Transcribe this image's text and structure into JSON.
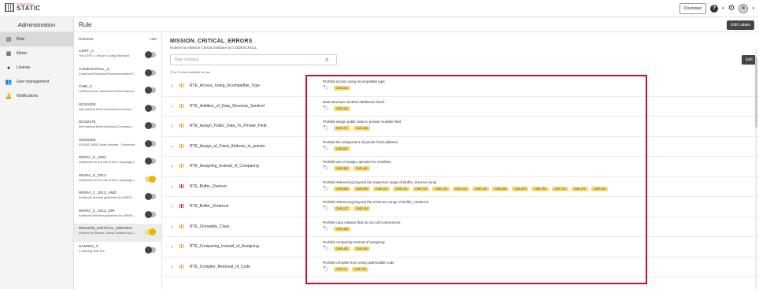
{
  "header": {
    "logo_small": "CODESCROLL",
    "logo_big": "STATIC",
    "download_label": "Download",
    "help_icon": "?"
  },
  "sidebar": {
    "title": "Administration",
    "items": [
      {
        "label": "Rule",
        "icon": "rule-book-icon",
        "active": true
      },
      {
        "label": "Metric",
        "icon": "metric-icon"
      },
      {
        "label": "License",
        "icon": "license-icon"
      },
      {
        "label": "User management",
        "icon": "users-icon"
      },
      {
        "label": "Notifications",
        "icon": "bell-icon"
      }
    ]
  },
  "page": {
    "title": "Rule",
    "edit_labels": "Edit Labels"
  },
  "rulesets": {
    "header_label": "Rulesets",
    "header_use": "Use",
    "items": [
      {
        "name": "CERT_C",
        "desc": "The CERT C Secure Coding Standard",
        "on": false
      },
      {
        "name": "CODESCROLL_C",
        "desc": "CodeScroll Essential Recommendation R...",
        "on": false
      },
      {
        "name": "CWE_C",
        "desc": "CWE(Common Weakness Enumeration) f...",
        "on": false
      },
      {
        "name": "IEC61508",
        "desc": "International Electrotechnical Commissi...",
        "on": false
      },
      {
        "name": "IEC62279",
        "desc": "International Electrotechnical Commissi...",
        "on": false
      },
      {
        "name": "ISO26262",
        "desc": "ISO/DIS 26262 Road vehicles - Functional ...",
        "on": false
      },
      {
        "name": "MISRA_C_2004",
        "desc": "Guidelines for the use of the C language i...",
        "on": false
      },
      {
        "name": "MISRA_C_2012",
        "desc": "Guidelines for the use of the C language i...",
        "on": true
      },
      {
        "name": "MISRA_C_2012_AMD",
        "desc": "Additional security guidelines for MISRA ...",
        "on": false
      },
      {
        "name": "MISRA_C_2012_DIR",
        "desc": "Additional directive guidelines for MISRA ...",
        "on": false
      },
      {
        "name": "MISSION_CRITICAL_ERRORS",
        "desc": "Ruleset for Mission Critical Software by C...",
        "on": true,
        "active": true
      },
      {
        "name": "NAMING_C",
        "desc": "C Naming Rule Set",
        "on": false
      }
    ]
  },
  "content": {
    "title": "MISSION_CRITICAL_ERRORS",
    "subtitle": "Ruleset for Mission Critical Software by CODESCROLL",
    "search_placeholder": "Rule contains",
    "edit_label": "Edit",
    "selected_info": "75 of 75 rules selected for use"
  },
  "rules": [
    {
      "name": "RTE_Access_Using_Incompatible_Type",
      "severity": "medium",
      "desc": "Prohibit access using incompatible type",
      "tags": [
        "CWE-843"
      ]
    },
    {
      "name": "RTE_Addition_of_Data_Structure_Sentinel",
      "severity": "medium",
      "desc": "Data structure sentinel additional check",
      "tags": [
        "CWE-464"
      ]
    },
    {
      "name": "RTE_Assign_Public_Data_To_Private_Field",
      "severity": "medium",
      "desc": "Prohibit assign public data to private mutable field",
      "tags": [
        "CWE-767",
        "CWE-496"
      ]
    },
    {
      "name": "RTE_Assign_of_Fixed_Address_to_pointer",
      "severity": "medium",
      "desc": "Prohibit the assignment of pointer fixed address",
      "tags": [
        "CWE-587"
      ]
    },
    {
      "name": "RTE_Assigning_Instead_of_Comparing",
      "severity": "medium",
      "desc": "Prohibit use of assign operator for condition",
      "tags": [
        "CWE-480",
        "CWE-481"
      ]
    },
    {
      "name": "RTE_Buffer_Overrun",
      "severity": "high",
      "desc": "Prohibit referencing beyond the maximum range of Buffer_Overrun array",
      "tags": [
        "CWE-806",
        "CWE-805",
        "CWE-122",
        "CWE-121",
        "CWE-170",
        "CWE-125",
        "CWE-126",
        "CWE-130",
        "CWE-466",
        "CWE-679",
        "CWE-785",
        "CWE-120",
        "CWE-242",
        "CWE-463"
      ]
    },
    {
      "name": "RTE_Buffer_Underrun",
      "severity": "high",
      "desc": "Prohibit referencing beyond the minimum range of Buffer_Underrun",
      "tags": [
        "CWE-127",
        "CWE-124"
      ]
    },
    {
      "name": "RTE_Cloneable_Class",
      "severity": "medium",
      "desc": "Prohibit copy classes that do not call constructors",
      "tags": [
        "CWE-498"
      ]
    },
    {
      "name": "RTE_Comparing_Instead_of_Assigning",
      "severity": "medium",
      "desc": "Prohibit comparing instead of assigning",
      "tags": [
        "CWE-482",
        "CWE-480"
      ]
    },
    {
      "name": "RTE_Compiler_Removal_of_Code",
      "severity": "medium",
      "desc": "Prohibit compiler from using optimizable code",
      "tags": [
        "CWE-14",
        "CWE-733"
      ]
    }
  ]
}
